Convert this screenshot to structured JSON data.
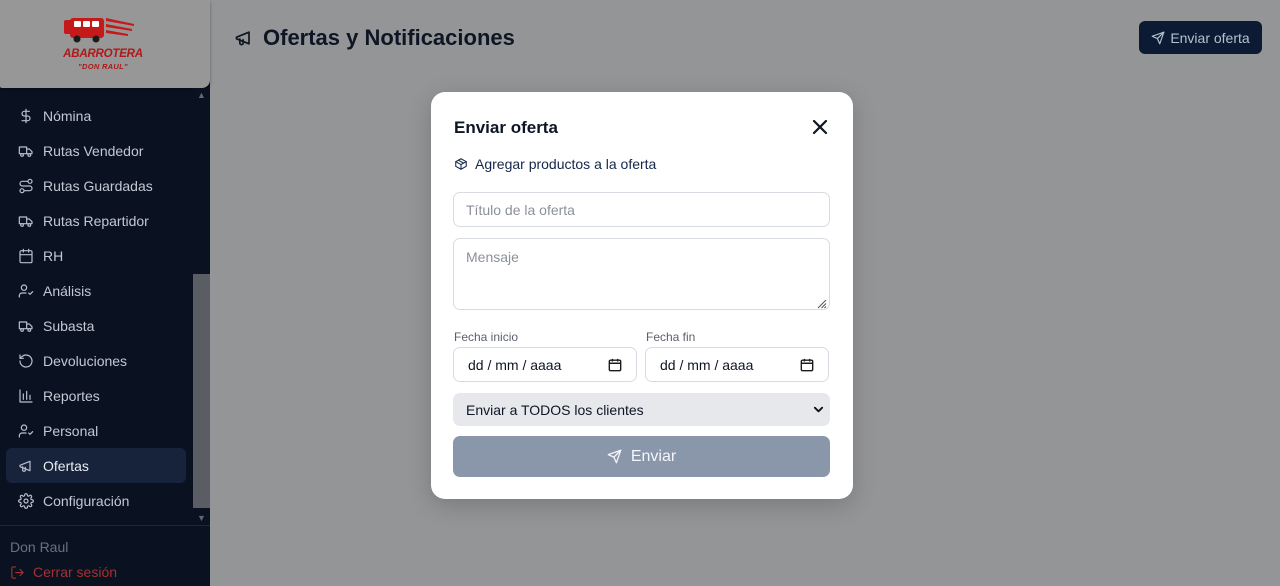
{
  "brand": {
    "logo_line1": "ABARROTERA",
    "logo_line2": "\"DON RAUL\"",
    "logo_color": "#b01818"
  },
  "sidebar": {
    "items": [
      {
        "label": "Nómina",
        "icon": "dollar-icon"
      },
      {
        "label": "Rutas Vendedor",
        "icon": "truck-icon"
      },
      {
        "label": "Rutas Guardadas",
        "icon": "route-icon"
      },
      {
        "label": "Rutas Repartidor",
        "icon": "truck-icon"
      },
      {
        "label": "RH",
        "icon": "calendar-icon"
      },
      {
        "label": "Análisis",
        "icon": "user-check-icon"
      },
      {
        "label": "Subasta",
        "icon": "truck-icon"
      },
      {
        "label": "Devoluciones",
        "icon": "rotate-ccw-icon"
      },
      {
        "label": "Reportes",
        "icon": "bar-chart-icon"
      },
      {
        "label": "Personal",
        "icon": "user-check-icon"
      },
      {
        "label": "Ofertas",
        "icon": "megaphone-icon",
        "active": true
      },
      {
        "label": "Configuración",
        "icon": "gear-icon"
      }
    ],
    "user_name": "Don Raul",
    "logout_label": "Cerrar sesión"
  },
  "header": {
    "title": "Ofertas y Notificaciones",
    "title_icon": "megaphone-icon",
    "send_offer_label": "Enviar oferta"
  },
  "modal": {
    "title": "Enviar oferta",
    "add_products_label": "Agregar productos a la oferta",
    "title_placeholder": "Título de la oferta",
    "message_placeholder": "Mensaje",
    "start_label": "Fecha inicio",
    "end_label": "Fecha fin",
    "date_placeholder": "dd / mm / aaaa",
    "recipients_value": "Enviar a TODOS los clientes",
    "submit_label": "Enviar"
  },
  "colors": {
    "sidebar_bg": "#0a1222",
    "overlay": "#949596",
    "primary": "#0c1a33",
    "submit_disabled": "#8a97ab",
    "logout": "#a23232"
  }
}
